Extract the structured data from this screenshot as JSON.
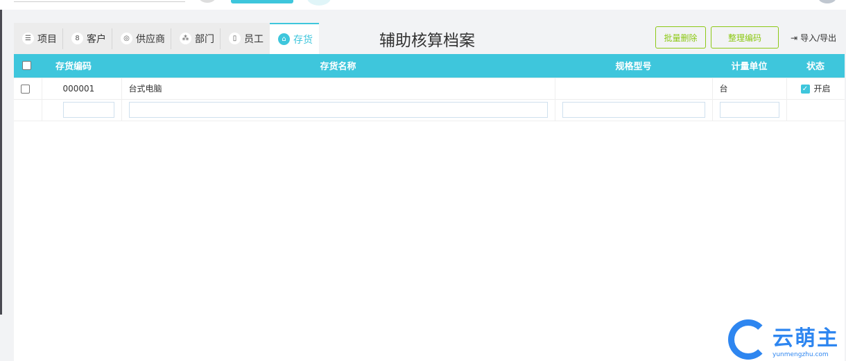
{
  "tabs": [
    {
      "label": "项目",
      "icon": "list-icon"
    },
    {
      "label": "客户",
      "icon": "users-icon"
    },
    {
      "label": "供应商",
      "icon": "supplier-icon"
    },
    {
      "label": "部门",
      "icon": "org-icon"
    },
    {
      "label": "员工",
      "icon": "badge-icon"
    },
    {
      "label": "存货",
      "icon": "home-icon",
      "active": true
    }
  ],
  "title": "辅助核算档案",
  "buttons": {
    "batch_delete": "批量删除",
    "reorder_codes": "整理编码",
    "import_export": "导入/导出"
  },
  "table": {
    "headers": [
      "存货编码",
      "存货名称",
      "规格型号",
      "计量单位",
      "状态"
    ],
    "rows": [
      {
        "code": "000001",
        "name": "台式电脑",
        "spec": "",
        "unit": "台",
        "status": "开启",
        "status_checked": true
      }
    ]
  },
  "logo": {
    "cn": "云萌主",
    "en": "yunmengzhu.com"
  },
  "colors": {
    "accent": "#3ec6dc",
    "green": "#8cc814",
    "logo": "#2e86f0"
  }
}
